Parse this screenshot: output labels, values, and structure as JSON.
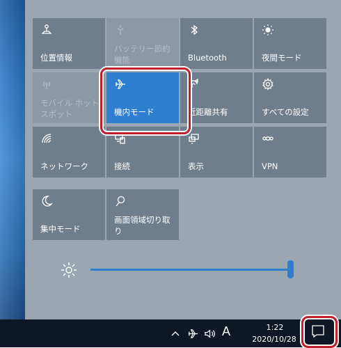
{
  "tiles": [
    {
      "id": "location",
      "label": "位置情報",
      "state": "normal",
      "icon": "location-icon"
    },
    {
      "id": "battery-saver",
      "label": "バッテリー節約機能",
      "state": "disabled",
      "icon": "battery-saver-icon"
    },
    {
      "id": "bluetooth",
      "label": "Bluetooth",
      "state": "normal",
      "icon": "bluetooth-icon"
    },
    {
      "id": "night-light",
      "label": "夜間モード",
      "state": "normal",
      "icon": "night-light-icon"
    },
    {
      "id": "mobile-hotspot",
      "label": "モバイル ホットスポット",
      "state": "disabled",
      "icon": "hotspot-icon"
    },
    {
      "id": "airplane-mode",
      "label": "機内モード",
      "state": "active",
      "icon": "airplane-icon"
    },
    {
      "id": "nearby-sharing",
      "label": "近距離共有",
      "state": "normal",
      "icon": "nearby-share-icon"
    },
    {
      "id": "all-settings",
      "label": "すべての設定",
      "state": "normal",
      "icon": "gear-icon"
    },
    {
      "id": "network",
      "label": "ネットワーク",
      "state": "normal",
      "icon": "network-icon"
    },
    {
      "id": "connect",
      "label": "接続",
      "state": "normal",
      "icon": "connect-icon"
    },
    {
      "id": "project",
      "label": "表示",
      "state": "normal",
      "icon": "project-icon"
    },
    {
      "id": "vpn",
      "label": "VPN",
      "state": "normal",
      "icon": "vpn-icon"
    },
    {
      "id": "focus-assist",
      "label": "集中モード",
      "state": "normal",
      "icon": "moon-icon"
    },
    {
      "id": "snip",
      "label": "画面領域切り取り",
      "state": "normal",
      "icon": "snip-icon"
    }
  ],
  "brightness": {
    "value": 1.0,
    "icon": "sun-icon"
  },
  "taskbar": {
    "ime": "A",
    "time": "1:22",
    "date": "2020/10/28",
    "icons": [
      "chevron-up-icon",
      "airplane-icon",
      "speaker-icon",
      "notification-icon"
    ]
  },
  "colors": {
    "panel": "#9aa6b1",
    "tile": "#6f7e8c",
    "active": "#2f7fd0",
    "highlight": "#c0202a",
    "taskbar": "#0f1726"
  }
}
